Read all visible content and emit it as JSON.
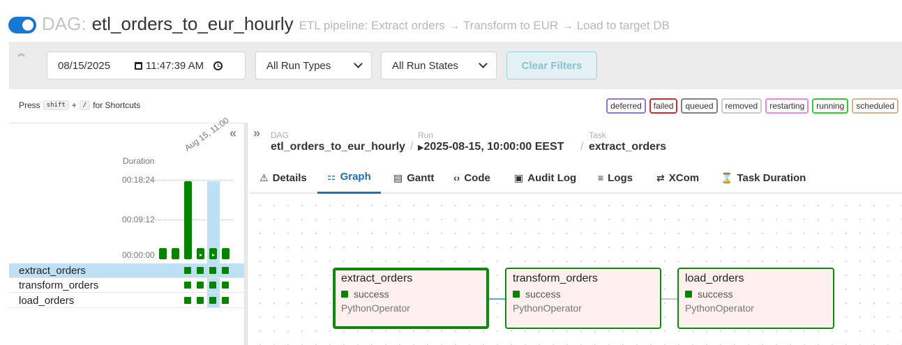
{
  "header": {
    "dag_label": "DAG:",
    "dag_id": "etl_orders_to_eur_hourly",
    "description": "ETL pipeline: Extract orders → Transform to EUR → Load to target DB",
    "toggle_on": true
  },
  "filters": {
    "date": "08/15/2025",
    "time": "11:47:39 AM",
    "run_types": "All Run Types",
    "run_states": "All Run States",
    "clear_label": "Clear Filters"
  },
  "shortcuts": {
    "press": "Press",
    "key1": "shift",
    "plus": "+",
    "key2": "/",
    "suffix": "for Shortcuts"
  },
  "legend": [
    {
      "label": "deferred",
      "color": "#9370db"
    },
    {
      "label": "failed",
      "color": "#d42a2a"
    },
    {
      "label": "queued",
      "color": "#808080"
    },
    {
      "label": "removed",
      "color": "#c9c9c9"
    },
    {
      "label": "restarting",
      "color": "#ee82ee"
    },
    {
      "label": "running",
      "color": "#32cd32"
    },
    {
      "label": "scheduled",
      "color": "#d2b48c"
    }
  ],
  "grid": {
    "duration_label": "Duration",
    "date_label": "Aug 15, 11:00",
    "y_ticks": [
      "00:18:24",
      "00:09:12",
      "00:00:00"
    ],
    "tasks": [
      "extract_orders",
      "transform_orders",
      "load_orders"
    ],
    "selected_task": "extract_orders",
    "success_color": "#068400"
  },
  "breadcrumb": {
    "dag_small": "DAG",
    "dag": "etl_orders_to_eur_hourly",
    "run_small": "Run",
    "run": "2025-08-15, 10:00:00 EEST",
    "task_small": "Task",
    "task": "extract_orders"
  },
  "tabs": [
    {
      "label": "Details",
      "icon": "warning-icon"
    },
    {
      "label": "Graph",
      "icon": "graph-icon"
    },
    {
      "label": "Gantt",
      "icon": "gantt-icon"
    },
    {
      "label": "Code",
      "icon": "code-icon"
    },
    {
      "label": "Audit Log",
      "icon": "audit-log-icon"
    },
    {
      "label": "Logs",
      "icon": "logs-icon"
    },
    {
      "label": "XCom",
      "icon": "xcom-icon"
    },
    {
      "label": "Task Duration",
      "icon": "hourglass-icon"
    }
  ],
  "graph": {
    "nodes": [
      {
        "name": "extract_orders",
        "state": "success",
        "operator": "PythonOperator"
      },
      {
        "name": "transform_orders",
        "state": "success",
        "operator": "PythonOperator"
      },
      {
        "name": "load_orders",
        "state": "success",
        "operator": "PythonOperator"
      }
    ]
  }
}
